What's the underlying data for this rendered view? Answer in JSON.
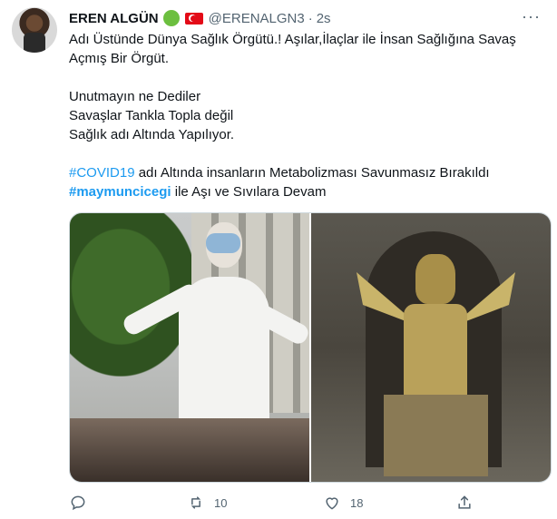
{
  "tweet": {
    "author_name": "EREN ALGÜN",
    "handle": "@ERENALGN3",
    "separator": "·",
    "time": "2s",
    "more": "···",
    "text_lines": {
      "l1": "Adı Üstünde Dünya Sağlık Örgütü.! Aşılar,İlaçlar ile İnsan Sağlığına Savaş",
      "l2": "Açmış Bir Örgüt.",
      "l3": "Unutmayın ne Dediler",
      "l4": "Savaşlar Tankla Topla değil",
      "l5": "Sağlık adı Altında Yapılıyor.",
      "l6_tag": "#COVID19",
      "l6_rest": " adı Altında insanların Metabolizması Savunmasız Bırakıldı",
      "l7_tag": "#maymuncicegi",
      "l7_rest": " ile Aşı ve Sıvılara  Devam"
    },
    "actions": {
      "reply_count": "",
      "retweet_count": "10",
      "like_count": "18",
      "share_count": ""
    }
  },
  "icons": {
    "reply": "reply-icon",
    "retweet": "retweet-icon",
    "like": "heart-icon",
    "share": "share-icon",
    "more": "more-icon"
  },
  "colors": {
    "link": "#1d9bf0",
    "text": "#0f1419",
    "muted": "#536471",
    "badge_green": "#6cbf3f",
    "flag_red": "#e30a17"
  }
}
